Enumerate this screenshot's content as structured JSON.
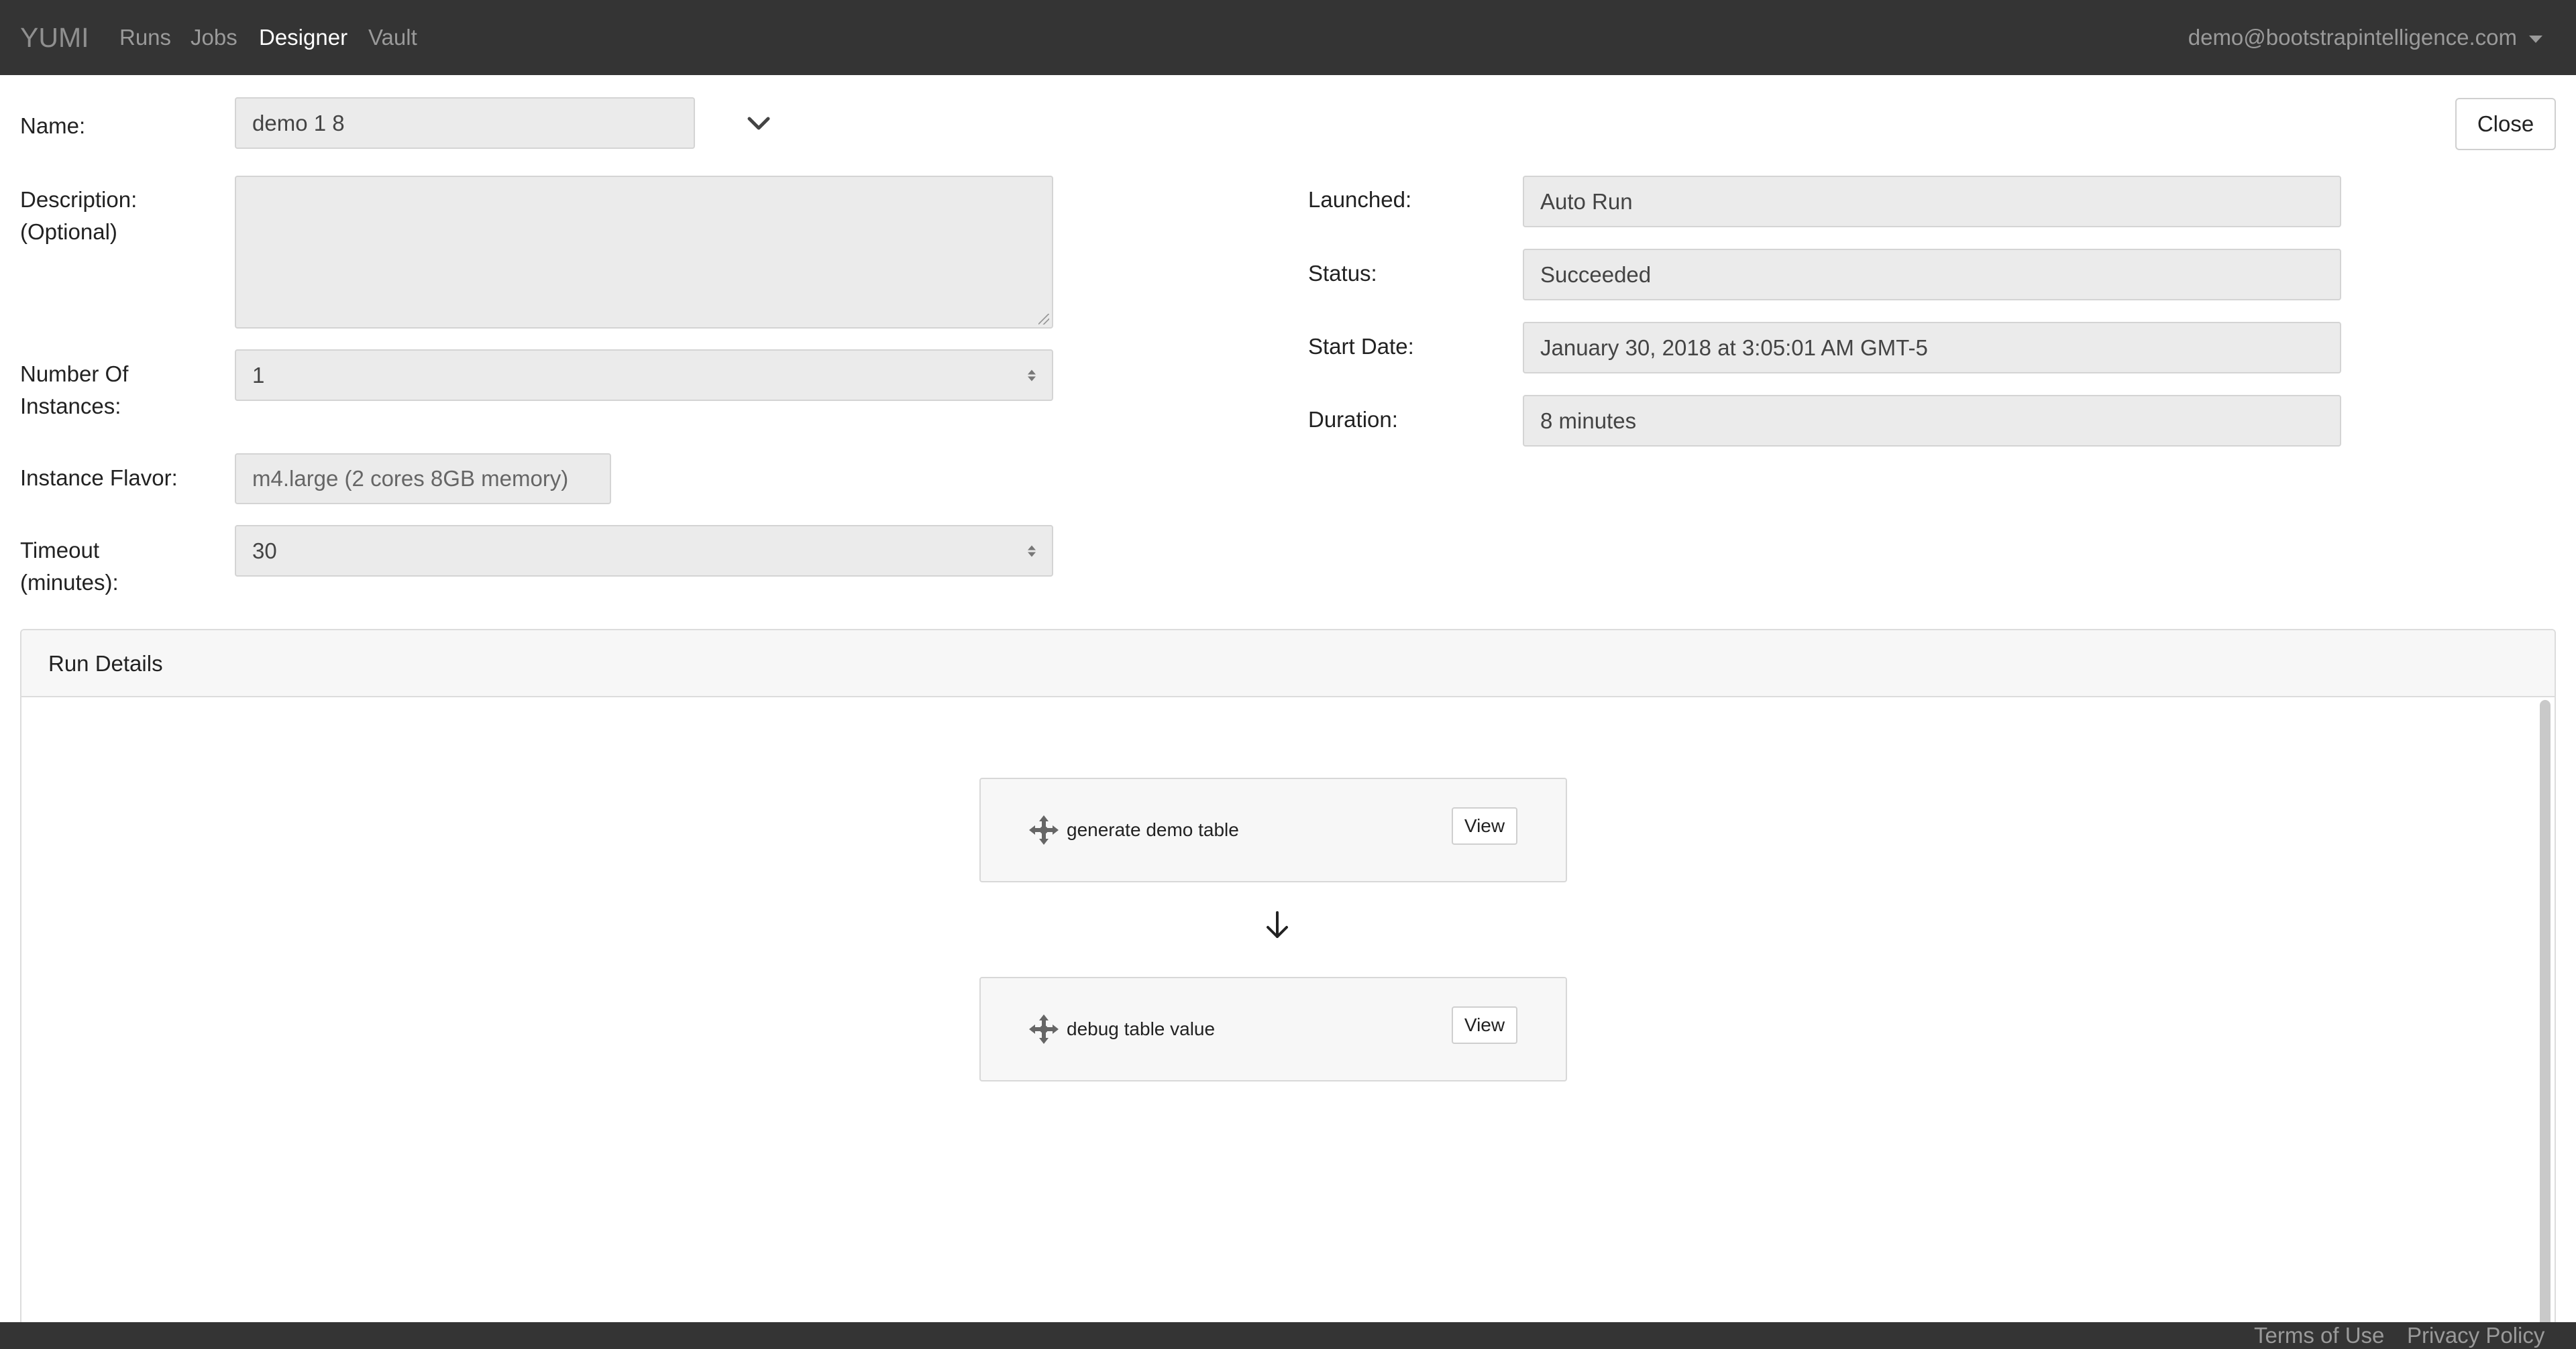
{
  "navbar": {
    "brand": "YUMI",
    "links": [
      {
        "label": "Runs",
        "active": false
      },
      {
        "label": "Jobs",
        "active": false
      },
      {
        "label": "Designer",
        "active": true
      },
      {
        "label": "Vault",
        "active": false
      }
    ],
    "user": "demo@bootstrapintelligence.com"
  },
  "form": {
    "name": {
      "label": "Name:",
      "value": "demo 1 8"
    },
    "description": {
      "label_line1": "Description:",
      "label_line2": "(Optional)",
      "value": ""
    },
    "instances": {
      "label_line1": "Number Of",
      "label_line2": "Instances:",
      "value": "1"
    },
    "flavor": {
      "label": "Instance Flavor:",
      "value": "m4.large (2 cores 8GB memory)"
    },
    "timeout": {
      "label_line1": "Timeout",
      "label_line2": "(minutes):",
      "value": "30"
    },
    "close_label": "Close"
  },
  "run_info": {
    "launched": {
      "label": "Launched:",
      "value": "Auto Run"
    },
    "status": {
      "label": "Status:",
      "value": "Succeeded"
    },
    "start_date": {
      "label": "Start Date:",
      "value": "January 30, 2018 at 3:05:01 AM GMT-5"
    },
    "duration": {
      "label": "Duration:",
      "value": "8 minutes"
    }
  },
  "run_details": {
    "title": "Run Details",
    "nodes": [
      {
        "label": "generate demo table",
        "button": "View"
      },
      {
        "label": "debug table value",
        "button": "View"
      }
    ]
  },
  "footer": {
    "terms": "Terms of Use",
    "privacy": "Privacy Policy"
  },
  "colors": {
    "navbar_bg": "#343434",
    "field_bg": "#ebebeb",
    "panel_header_bg": "#f7f7f7"
  }
}
